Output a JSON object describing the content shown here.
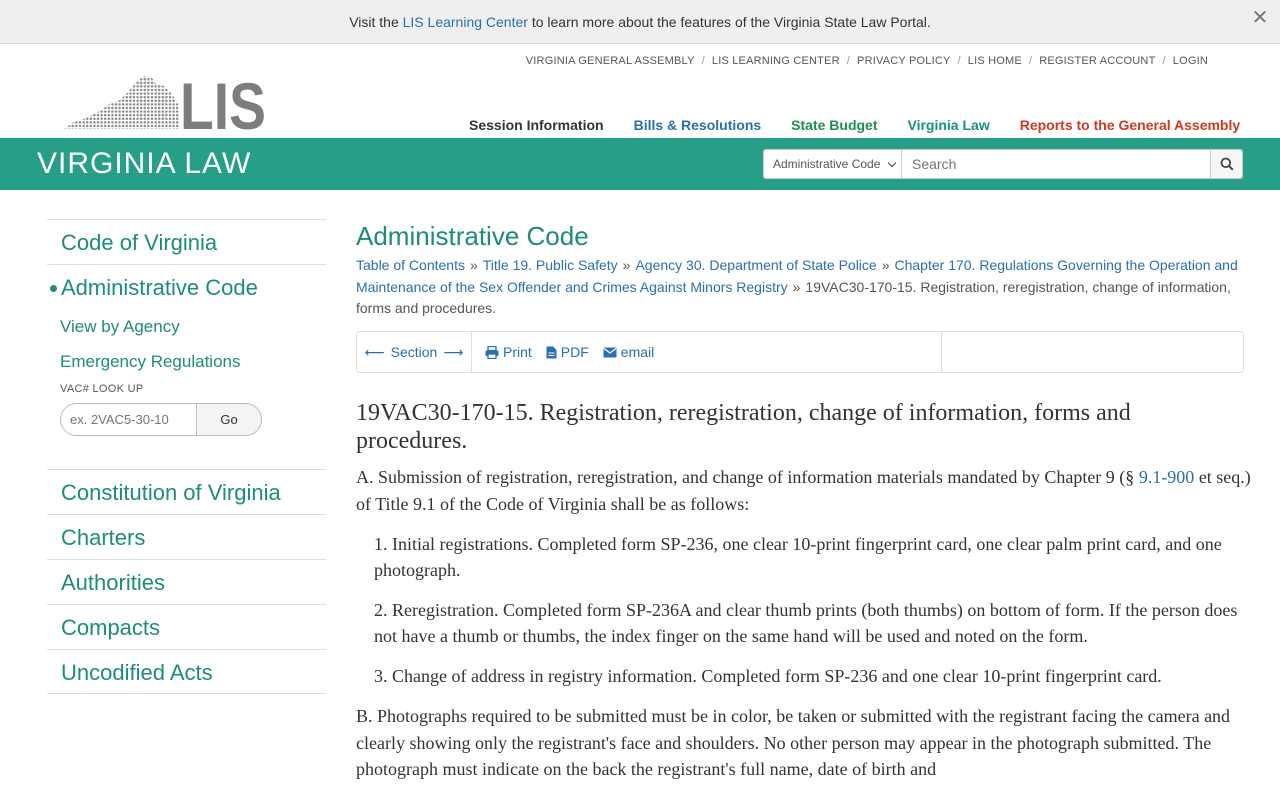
{
  "banner": {
    "prefix": "Visit the ",
    "link": "LIS Learning Center",
    "suffix": " to learn more about the features of the Virginia State Law Portal."
  },
  "utility_nav": [
    "VIRGINIA GENERAL ASSEMBLY",
    "LIS LEARNING CENTER",
    "PRIVACY POLICY",
    "LIS HOME",
    "REGISTER ACCOUNT",
    "LOGIN"
  ],
  "logo_text": "LIS",
  "main_nav": [
    "Session Information",
    "Bills & Resolutions",
    "State Budget",
    "Virginia Law",
    "Reports to the General Assembly"
  ],
  "bar": {
    "title": "VIRGINIA LAW",
    "select_value": "Administrative Code",
    "search_placeholder": "Search"
  },
  "sidebar": {
    "items": [
      "Code of Virginia",
      "Administrative Code"
    ],
    "subitems": [
      "View by Agency",
      "Emergency Regulations"
    ],
    "vac_label": "VAC# LOOK UP",
    "vac_placeholder": "ex. 2VAC5-30-10",
    "go_label": "Go",
    "items_after": [
      "Constitution of Virginia",
      "Charters",
      "Authorities",
      "Compacts",
      "Uncodified Acts"
    ]
  },
  "content": {
    "title": "Administrative Code",
    "breadcrumbs": [
      "Table of Contents",
      "Title 19. Public Safety",
      "Agency 30. Department of State Police",
      "Chapter 170. Regulations Governing the Operation and Maintenance of the Sex Offender and Crimes Against Minors Registry"
    ],
    "breadcrumb_current": "19VAC30-170-15. Registration, reregistration, change of information, forms and procedures.",
    "toolbar": {
      "section": "Section",
      "print": "Print",
      "pdf": "PDF",
      "email": "email"
    },
    "heading": "19VAC30-170-15. Registration, reregistration, change of information, forms and procedures.",
    "para_a_before": "A. Submission of registration, reregistration, and change of information materials mandated by Chapter 9 (§ ",
    "para_a_link": "9.1-900",
    "para_a_after": " et seq.) of Title 9.1 of the Code of Virginia shall be as follows:",
    "items": [
      "1. Initial registrations. Completed form SP-236, one clear 10-print fingerprint card, one clear palm print card, and one photograph.",
      "2. Reregistration. Completed form SP-236A and clear thumb prints (both thumbs) on bottom of form. If the person does not have a thumb or thumbs, the index finger on the same hand will be used and noted on the form.",
      "3. Change of address in registry information. Completed form SP-236 and one clear 10-print fingerprint card."
    ],
    "para_b": "B. Photographs required to be submitted must be in color, be taken or submitted with the registrant facing the camera and clearly showing only the registrant's face and shoulders. No other person may appear in the photograph submitted. The photograph must indicate on the back the registrant's full name, date of birth and"
  },
  "colors": {
    "teal": "#279e87",
    "link": "#2a6fb0"
  }
}
